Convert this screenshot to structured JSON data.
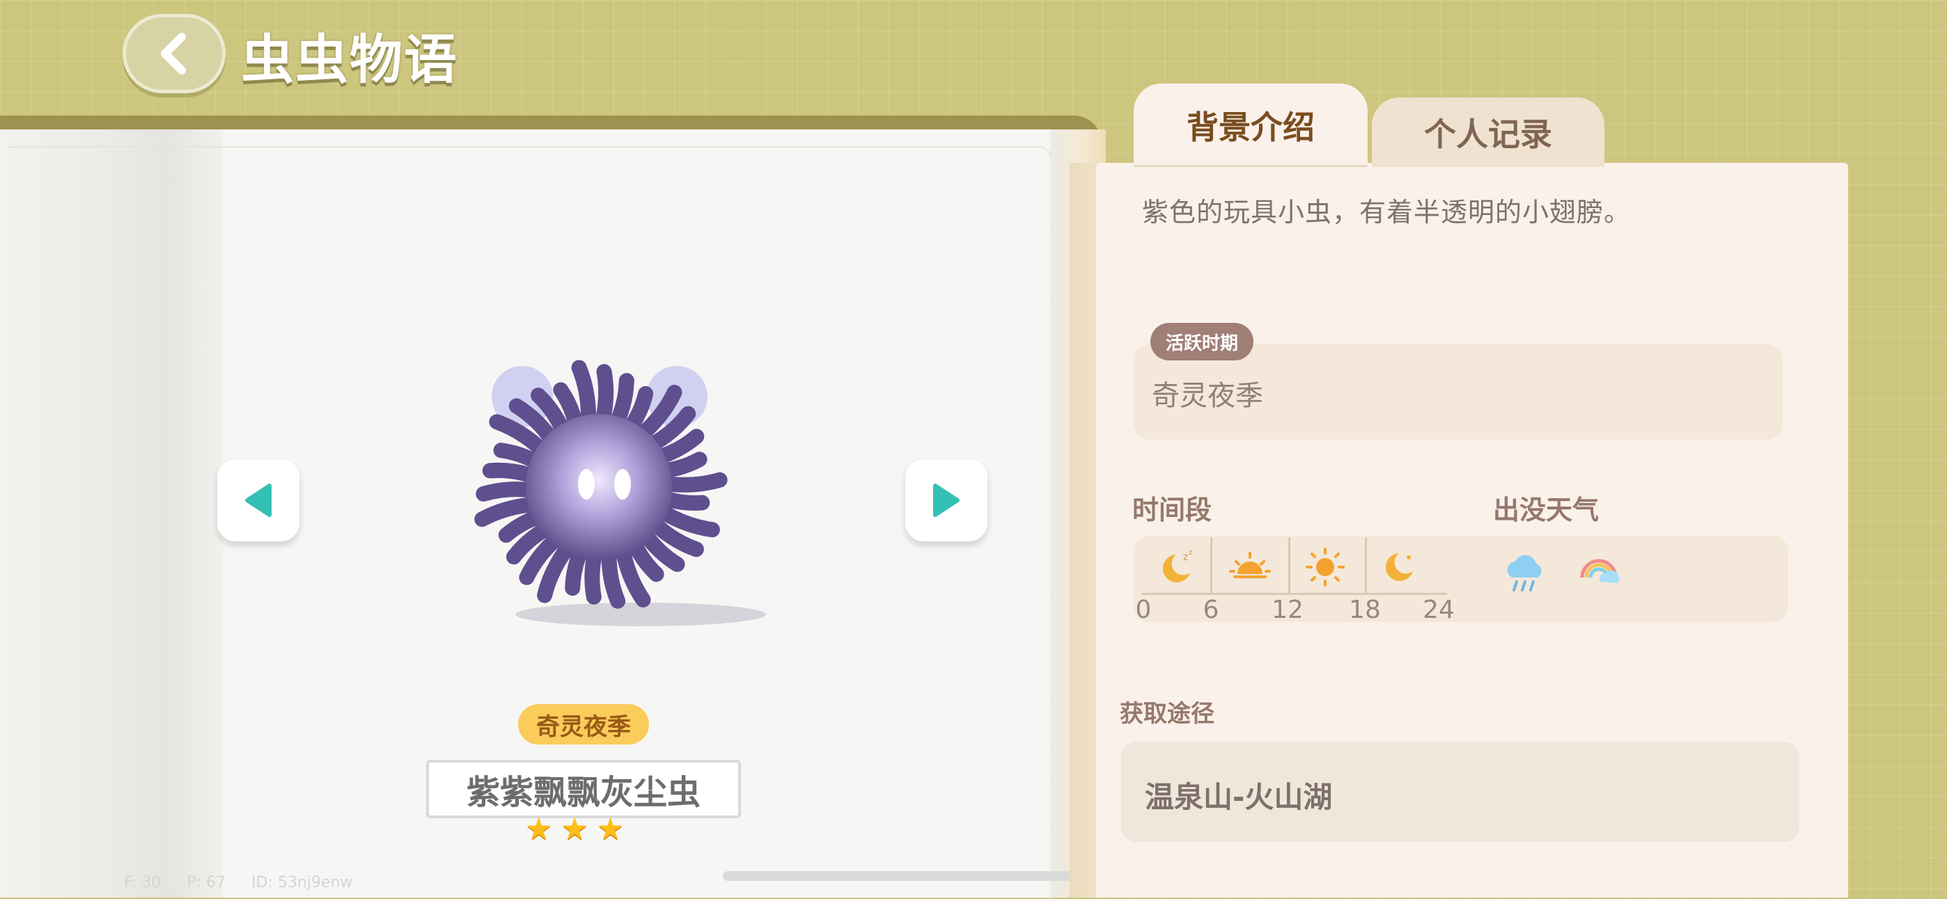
{
  "header": {
    "title": "虫虫物语",
    "back_icon": "chevron-left-icon"
  },
  "book": {
    "nav": {
      "prev_icon": "triangle-left-icon",
      "next_icon": "triangle-right-icon",
      "accent": "#34c0b5"
    },
    "bug": {
      "season_badge": "奇灵夜季",
      "name": "紫紫飘飘灰尘虫",
      "stars": [
        "★",
        "★",
        "★"
      ],
      "rarity": 3,
      "body_color": "#6f5f9c"
    }
  },
  "debug": {
    "f": "F: 30",
    "p": "P: 67",
    "id": "ID: 53nj9enw"
  },
  "panel": {
    "tabs": [
      {
        "label": "背景介绍",
        "active": true
      },
      {
        "label": "个人记录",
        "active": false
      }
    ],
    "description": "紫色的玩具小虫，有着半透明的小翅膀。",
    "active_period": {
      "label": "活跃时期",
      "value": "奇灵夜季"
    },
    "time_section": {
      "title": "时间段",
      "ticks": [
        "0",
        "6",
        "12",
        "18",
        "24"
      ],
      "icons": [
        "moon-sleep-icon",
        "sunrise-icon",
        "sun-icon",
        "crescent-moon-icon"
      ]
    },
    "weather_section": {
      "title": "出没天气",
      "icons": [
        "rain-cloud-icon",
        "rainbow-icon"
      ]
    },
    "acquisition": {
      "title": "获取途径",
      "value": "温泉山-火山湖"
    }
  },
  "colors": {
    "background": "#cdc67e",
    "panel": "#faf1ea",
    "star": "#ffbe1a",
    "badge": "#f9cc5c"
  }
}
